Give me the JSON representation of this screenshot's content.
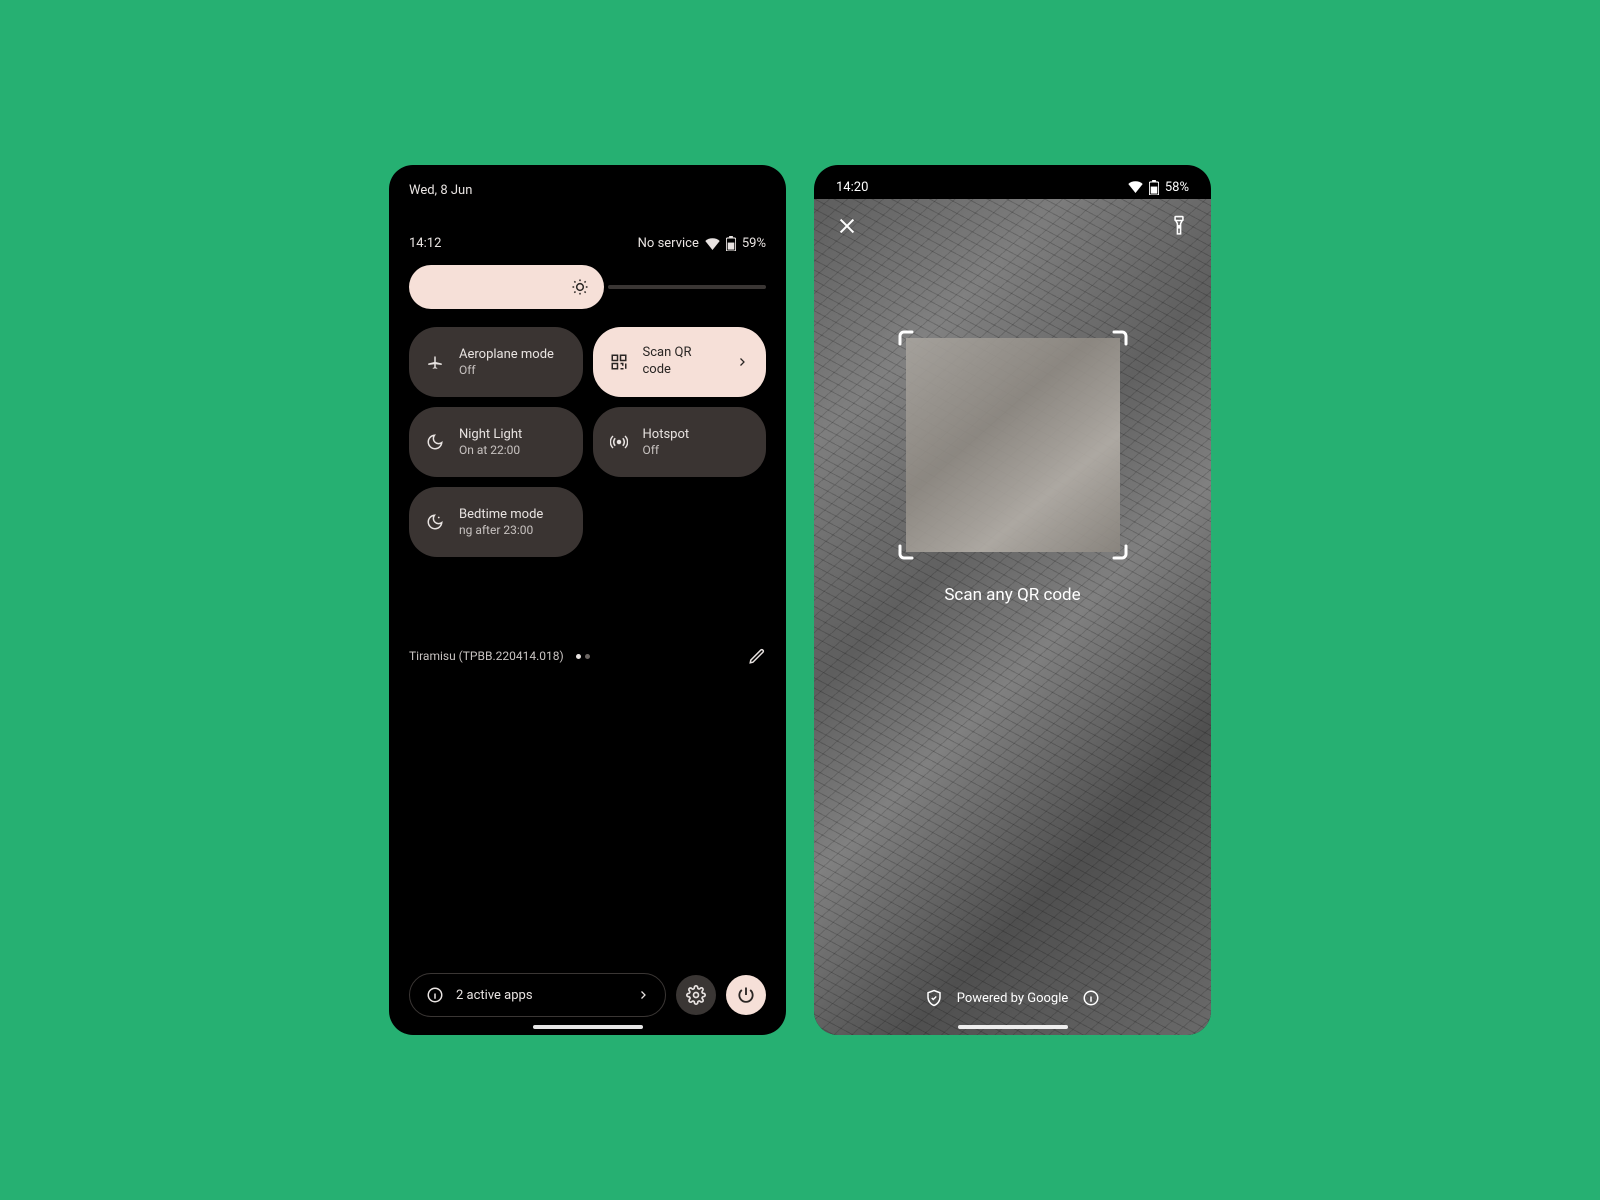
{
  "left": {
    "date": "Wed, 8 Jun",
    "time": "14:12",
    "service": "No service",
    "battery": "59%",
    "tiles": [
      {
        "title": "Aeroplane mode",
        "sub": "Off"
      },
      {
        "title": "Scan QR code",
        "sub": ""
      },
      {
        "title": "Night Light",
        "sub": "On at 22:00"
      },
      {
        "title": "Hotspot",
        "sub": "Off"
      },
      {
        "title": "Bedtime mode",
        "sub": "ng after 23:00"
      }
    ],
    "version": "Tiramisu (TPBB.220414.018)",
    "active_apps": "2 active apps"
  },
  "right": {
    "time": "14:20",
    "battery": "58%",
    "prompt": "Scan any QR code",
    "powered": "Powered by Google"
  }
}
